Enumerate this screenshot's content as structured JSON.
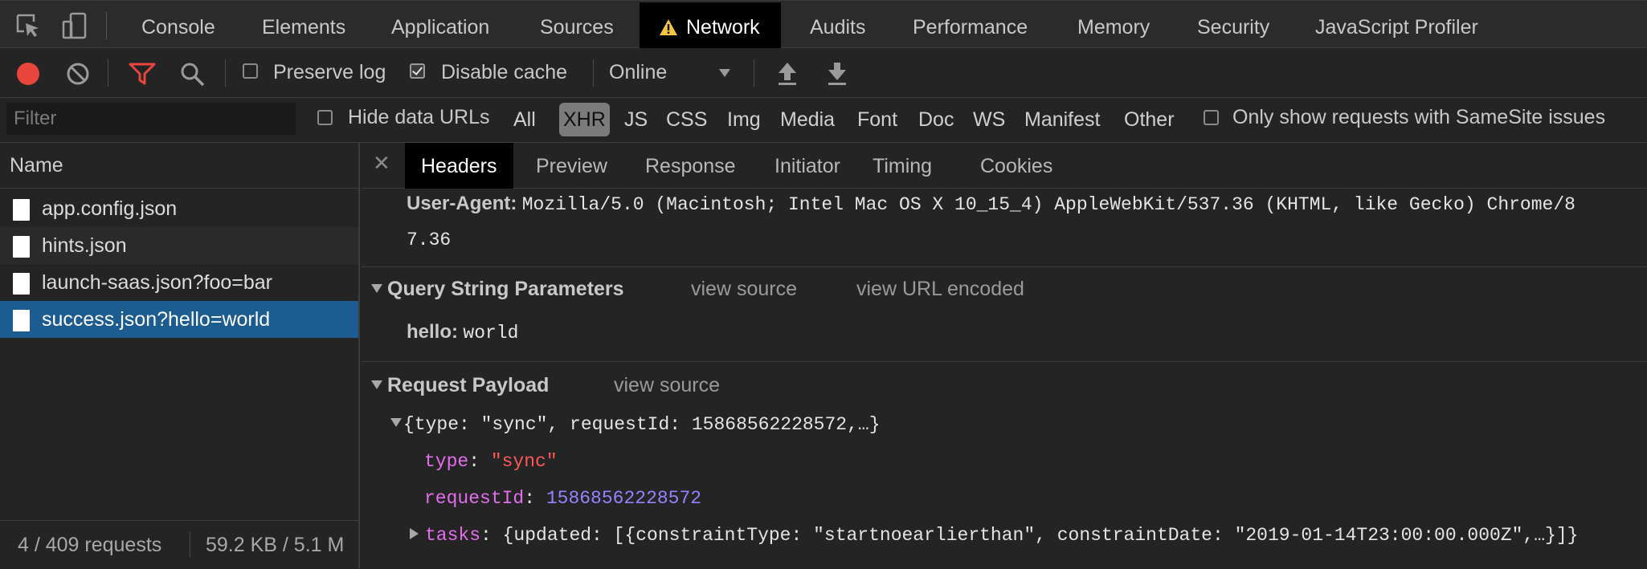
{
  "tabs": [
    {
      "label": "Console"
    },
    {
      "label": "Elements"
    },
    {
      "label": "Application"
    },
    {
      "label": "Sources"
    },
    {
      "label": "Network"
    },
    {
      "label": "Audits"
    },
    {
      "label": "Performance"
    },
    {
      "label": "Memory"
    },
    {
      "label": "Security"
    },
    {
      "label": "JavaScript Profiler"
    }
  ],
  "toolbar": {
    "preserve_log": "Preserve log",
    "disable_cache": "Disable cache",
    "throttling": "Online"
  },
  "filter": {
    "placeholder": "Filter",
    "hide_data_urls": "Hide data URLs",
    "types": [
      "All",
      "XHR",
      "JS",
      "CSS",
      "Img",
      "Media",
      "Font",
      "Doc",
      "WS",
      "Manifest",
      "Other"
    ],
    "selected_type": "XHR",
    "samesite": "Only show requests with SameSite issues"
  },
  "requests": {
    "header": "Name",
    "items": [
      {
        "name": "app.config.json"
      },
      {
        "name": "hints.json"
      },
      {
        "name": "launch-saas.json?foo=bar"
      },
      {
        "name": "success.json?hello=world"
      }
    ],
    "status_count": "4 / 409 requests",
    "status_size": "59.2 KB / 5.1 M"
  },
  "detail": {
    "tabs": [
      "Headers",
      "Preview",
      "Response",
      "Initiator",
      "Timing",
      "Cookies"
    ],
    "user_agent_key": "User-Agent:",
    "user_agent_line1": "Mozilla/5.0 (Macintosh; Intel Mac OS X 10_15_4) AppleWebKit/537.36 (KHTML, like Gecko) Chrome/8",
    "user_agent_line2": "7.36",
    "query_section": "Query String Parameters",
    "view_source": "view source",
    "view_url_encoded": "view URL encoded",
    "query_key": "hello:",
    "query_value": "world",
    "payload_section": "Request Payload",
    "payload_view_source": "view source",
    "payload_summary": "{type: \"sync\", requestId: 15868562228572,…}",
    "type_key": "type",
    "type_value": "\"sync\"",
    "request_id_key": "requestId",
    "request_id_value": "15868562228572",
    "tasks_key": "tasks",
    "tasks_value": "{updated: [{constraintType: \"startnoearlierthan\", constraintDate: \"2019-01-14T23:00:00.000Z\",…}]}"
  },
  "colors": {
    "record": "#e8453c",
    "filter_active": "#e8453c",
    "selected_row": "#1d5c91",
    "warning": "#f6c343"
  }
}
